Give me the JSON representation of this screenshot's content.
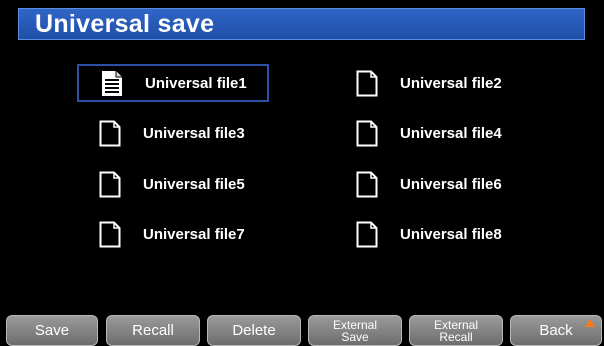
{
  "header": {
    "title": "Universal save"
  },
  "files": [
    {
      "label": "Universal file1",
      "icon": "document-filled-icon",
      "selected": true
    },
    {
      "label": "Universal file2",
      "icon": "document-empty-icon",
      "selected": false
    },
    {
      "label": "Universal file3",
      "icon": "document-empty-icon",
      "selected": false
    },
    {
      "label": "Universal file4",
      "icon": "document-empty-icon",
      "selected": false
    },
    {
      "label": "Universal file5",
      "icon": "document-empty-icon",
      "selected": false
    },
    {
      "label": "Universal file6",
      "icon": "document-empty-icon",
      "selected": false
    },
    {
      "label": "Universal file7",
      "icon": "document-empty-icon",
      "selected": false
    },
    {
      "label": "Universal file8",
      "icon": "document-empty-icon",
      "selected": false
    }
  ],
  "softkeys": {
    "save": "Save",
    "recall": "Recall",
    "delete": "Delete",
    "external_save_line1": "External",
    "external_save_line2": "Save",
    "external_recall_line1": "External",
    "external_recall_line2": "Recall",
    "back": "Back"
  },
  "colors": {
    "title_bar": "#2f66c7",
    "selection_border": "#2d4fa6",
    "back_arrow": "#ff7a1a"
  }
}
